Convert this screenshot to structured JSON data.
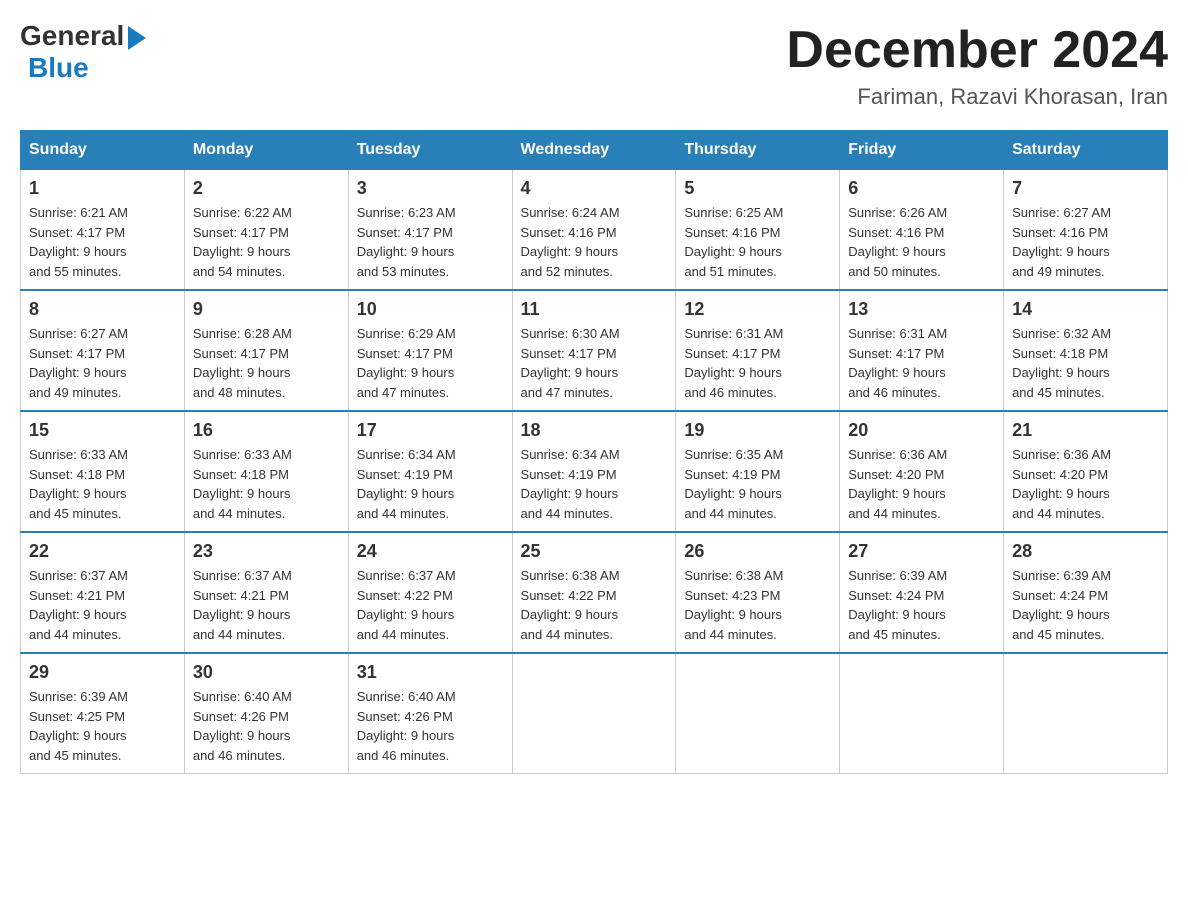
{
  "logo": {
    "general": "General",
    "blue": "Blue"
  },
  "title": "December 2024",
  "location": "Fariman, Razavi Khorasan, Iran",
  "days_of_week": [
    "Sunday",
    "Monday",
    "Tuesday",
    "Wednesday",
    "Thursday",
    "Friday",
    "Saturday"
  ],
  "weeks": [
    [
      {
        "day": "1",
        "sunrise": "6:21 AM",
        "sunset": "4:17 PM",
        "daylight": "9 hours and 55 minutes."
      },
      {
        "day": "2",
        "sunrise": "6:22 AM",
        "sunset": "4:17 PM",
        "daylight": "9 hours and 54 minutes."
      },
      {
        "day": "3",
        "sunrise": "6:23 AM",
        "sunset": "4:17 PM",
        "daylight": "9 hours and 53 minutes."
      },
      {
        "day": "4",
        "sunrise": "6:24 AM",
        "sunset": "4:16 PM",
        "daylight": "9 hours and 52 minutes."
      },
      {
        "day": "5",
        "sunrise": "6:25 AM",
        "sunset": "4:16 PM",
        "daylight": "9 hours and 51 minutes."
      },
      {
        "day": "6",
        "sunrise": "6:26 AM",
        "sunset": "4:16 PM",
        "daylight": "9 hours and 50 minutes."
      },
      {
        "day": "7",
        "sunrise": "6:27 AM",
        "sunset": "4:16 PM",
        "daylight": "9 hours and 49 minutes."
      }
    ],
    [
      {
        "day": "8",
        "sunrise": "6:27 AM",
        "sunset": "4:17 PM",
        "daylight": "9 hours and 49 minutes."
      },
      {
        "day": "9",
        "sunrise": "6:28 AM",
        "sunset": "4:17 PM",
        "daylight": "9 hours and 48 minutes."
      },
      {
        "day": "10",
        "sunrise": "6:29 AM",
        "sunset": "4:17 PM",
        "daylight": "9 hours and 47 minutes."
      },
      {
        "day": "11",
        "sunrise": "6:30 AM",
        "sunset": "4:17 PM",
        "daylight": "9 hours and 47 minutes."
      },
      {
        "day": "12",
        "sunrise": "6:31 AM",
        "sunset": "4:17 PM",
        "daylight": "9 hours and 46 minutes."
      },
      {
        "day": "13",
        "sunrise": "6:31 AM",
        "sunset": "4:17 PM",
        "daylight": "9 hours and 46 minutes."
      },
      {
        "day": "14",
        "sunrise": "6:32 AM",
        "sunset": "4:18 PM",
        "daylight": "9 hours and 45 minutes."
      }
    ],
    [
      {
        "day": "15",
        "sunrise": "6:33 AM",
        "sunset": "4:18 PM",
        "daylight": "9 hours and 45 minutes."
      },
      {
        "day": "16",
        "sunrise": "6:33 AM",
        "sunset": "4:18 PM",
        "daylight": "9 hours and 44 minutes."
      },
      {
        "day": "17",
        "sunrise": "6:34 AM",
        "sunset": "4:19 PM",
        "daylight": "9 hours and 44 minutes."
      },
      {
        "day": "18",
        "sunrise": "6:34 AM",
        "sunset": "4:19 PM",
        "daylight": "9 hours and 44 minutes."
      },
      {
        "day": "19",
        "sunrise": "6:35 AM",
        "sunset": "4:19 PM",
        "daylight": "9 hours and 44 minutes."
      },
      {
        "day": "20",
        "sunrise": "6:36 AM",
        "sunset": "4:20 PM",
        "daylight": "9 hours and 44 minutes."
      },
      {
        "day": "21",
        "sunrise": "6:36 AM",
        "sunset": "4:20 PM",
        "daylight": "9 hours and 44 minutes."
      }
    ],
    [
      {
        "day": "22",
        "sunrise": "6:37 AM",
        "sunset": "4:21 PM",
        "daylight": "9 hours and 44 minutes."
      },
      {
        "day": "23",
        "sunrise": "6:37 AM",
        "sunset": "4:21 PM",
        "daylight": "9 hours and 44 minutes."
      },
      {
        "day": "24",
        "sunrise": "6:37 AM",
        "sunset": "4:22 PM",
        "daylight": "9 hours and 44 minutes."
      },
      {
        "day": "25",
        "sunrise": "6:38 AM",
        "sunset": "4:22 PM",
        "daylight": "9 hours and 44 minutes."
      },
      {
        "day": "26",
        "sunrise": "6:38 AM",
        "sunset": "4:23 PM",
        "daylight": "9 hours and 44 minutes."
      },
      {
        "day": "27",
        "sunrise": "6:39 AM",
        "sunset": "4:24 PM",
        "daylight": "9 hours and 45 minutes."
      },
      {
        "day": "28",
        "sunrise": "6:39 AM",
        "sunset": "4:24 PM",
        "daylight": "9 hours and 45 minutes."
      }
    ],
    [
      {
        "day": "29",
        "sunrise": "6:39 AM",
        "sunset": "4:25 PM",
        "daylight": "9 hours and 45 minutes."
      },
      {
        "day": "30",
        "sunrise": "6:40 AM",
        "sunset": "4:26 PM",
        "daylight": "9 hours and 46 minutes."
      },
      {
        "day": "31",
        "sunrise": "6:40 AM",
        "sunset": "4:26 PM",
        "daylight": "9 hours and 46 minutes."
      },
      null,
      null,
      null,
      null
    ]
  ]
}
